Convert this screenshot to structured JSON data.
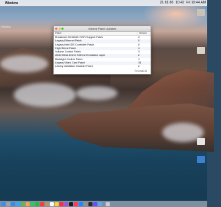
{
  "menubar": {
    "app_name": "Window",
    "status_items": [
      "21 61 86",
      "10:42",
      "Fri 10:44 AM"
    ]
  },
  "desktop": {
    "side_label": "Desktop"
  },
  "window": {
    "title": "Volume Patch Updates",
    "columns": {
      "patch": "Patch",
      "version": "Version"
    },
    "rows": [
      {
        "patch": "Broadcom BCM4321 WiFi Support Patch",
        "version": "3"
      },
      {
        "patch": "Legacy Ethernet Patch",
        "version": "0"
      },
      {
        "patch": "Legacy Intel IDE Controller Patch",
        "version": "0"
      },
      {
        "patch": "High Sierra Patch",
        "version": "4"
      },
      {
        "patch": "Volume Control Patch",
        "version": "3"
      },
      {
        "patch": "AMD Metal Driver SSE4.2 Emulation Layer",
        "version": "2"
      },
      {
        "patch": "Backlight Control Patch",
        "version": "1"
      },
      {
        "patch": "Legacy Video Card Patch",
        "version": "15"
      },
      {
        "patch": "Library Validation Disabler Patch",
        "version": "2"
      }
    ],
    "install_button": "Re-Install All"
  },
  "dock": {
    "icons": [
      "finder-icon",
      "launchpad-icon",
      "safari-icon",
      "mail-icon",
      "maps-icon",
      "photos-icon",
      "messages-icon",
      "facetime-icon",
      "calendar-icon",
      "contacts-icon",
      "reminders-icon",
      "notes-icon",
      "music-icon",
      "podcasts-icon",
      "tv-icon",
      "news-icon",
      "app-store-icon",
      "settings-icon",
      "terminal-icon",
      "patcher-icon",
      "folder-icon",
      "trash-icon"
    ],
    "colors": [
      "#3d8de8",
      "#9aa2ad",
      "#2f8fea",
      "#3aa6f0",
      "#5cb85c",
      "#f2a54a",
      "#34c759",
      "#30b54a",
      "#ff3b30",
      "#b8946a",
      "#f7f7f7",
      "#f5d33a",
      "#fa2d48",
      "#9b59d0",
      "#1c1c1e",
      "#ff375f",
      "#1e88ff",
      "#8e8e93",
      "#2b2b2b",
      "#6a4cff",
      "#5fa7e6",
      "#c9ccd1"
    ]
  }
}
